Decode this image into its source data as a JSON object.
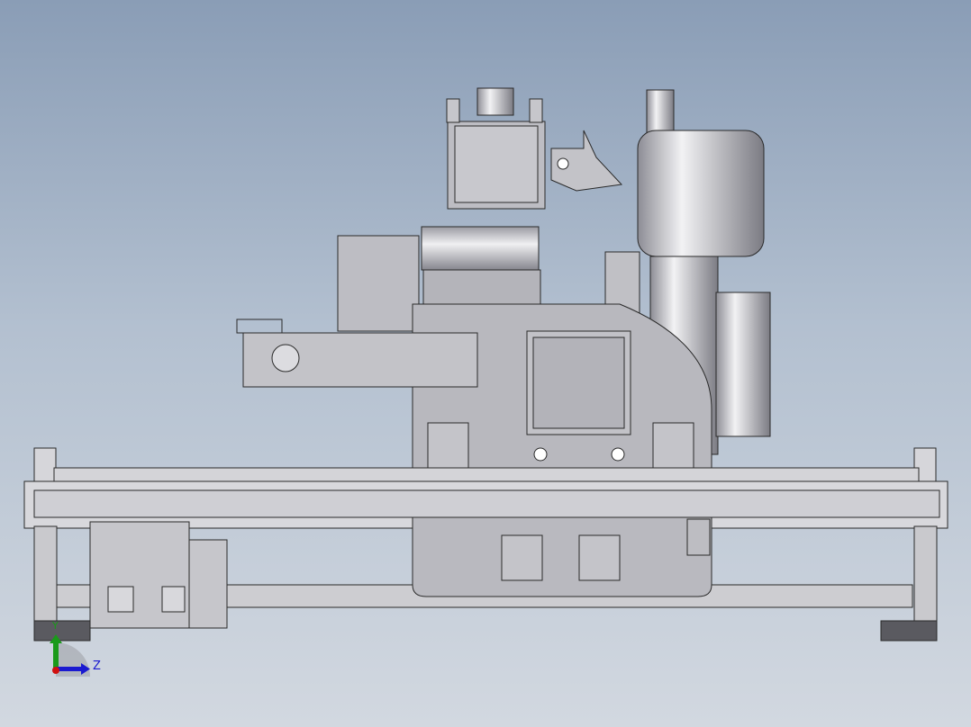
{
  "triad": {
    "y_label": "Y",
    "z_label": "Z",
    "y_color": "#1a9a1a",
    "z_color": "#1a1ad0",
    "x_color": "#d01010"
  },
  "colors": {
    "metal": "#c9c9cd",
    "plate": "#b9b9bf",
    "edge": "#2a2a2a"
  }
}
